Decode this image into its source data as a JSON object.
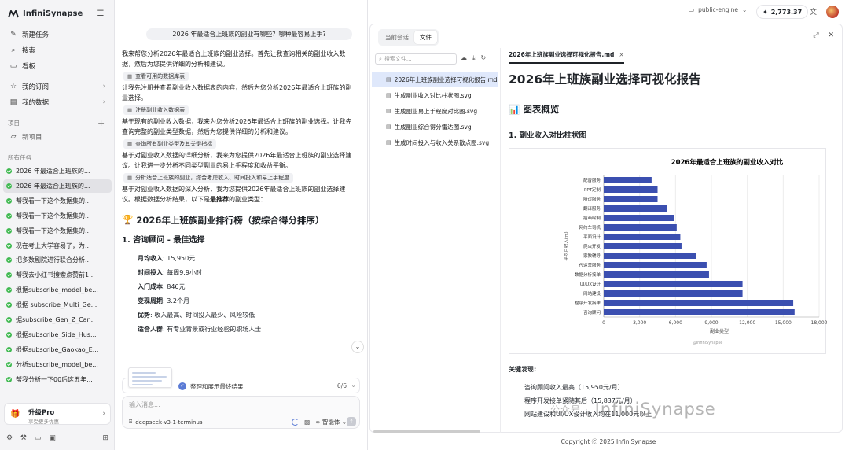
{
  "app": {
    "name": "InfiniSynapse"
  },
  "sidebar": {
    "nav": [
      {
        "label": "新建任务",
        "icon": "edit-icon"
      },
      {
        "label": "搜索",
        "icon": "search-icon"
      },
      {
        "label": "看板",
        "icon": "board-icon"
      },
      {
        "label": "我的订阅",
        "icon": "star-icon"
      },
      {
        "label": "我的数据",
        "icon": "data-icon"
      }
    ],
    "projects_label": "项目",
    "new_project": "新项目",
    "tasks_label": "所有任务",
    "tasks": [
      "2026 年最适合上班族的...",
      "2026 年最适合上班族的...",
      "帮我看一下这个数据集的...",
      "帮我看一下这个数据集的...",
      "帮我看一下这个数据集的...",
      "现在考上大学容易了，为...",
      "把多数剧院进行联合分析...",
      "帮我去小红书搜索点赞前1...",
      "根据subscribe_model_be...",
      "根据 subscribe_Multi_Ge...",
      "据subscribe_Gen_Z_Car...",
      "根据subscribe_Side_Hus...",
      "根据subscribe_Gaokao_E...",
      "分析subscribe_model_be...",
      "帮我分析一下00后这五年..."
    ],
    "active_task": 1,
    "upgrade": {
      "title": "升级Pro",
      "subtitle": "享受更多优惠"
    }
  },
  "chat": {
    "question": "2026 年最适合上班族的副业有哪些？哪种最容易上手?",
    "p1": "我来帮您分析2026年最适合上班族的副业选择。首先让我查询相关的副业收入数据，然后为您提供详细的分析和建议。",
    "tool1": "查看可用的数据库表",
    "p2": "让我先注册并查看副业收入数据表的内容，然后为您分析2026年最适合上班族的副业选择。",
    "tool2": "注册副业收入数据表",
    "p3": "基于现有的副业收入数据，我来为您分析2026年最适合上班族的副业选择。让我先查询完整的副业类型数据，然后为您提供详细的分析和建议。",
    "tool3": "查询所有副业类型及其关键指标",
    "p4": "基于对副业收入数据的详细分析，我来为您提供2026年最适合上班族的副业选择建议。让我进一步分析不同类型副业的易上手程度和收益平衡。",
    "tool4": "分析适合上班族的副业，综合考虑收入、时间投入和易上手程度",
    "p5a": "基于对副业收入数据的深入分析，我为您提供2026年最适合上班族的副业选择建议。根据数据分析结果，以下是",
    "p5b": "最推荐",
    "p5c": "的副业类型：",
    "rank_icon": "🏆",
    "rank_title": "2026年上班族副业排行榜（按综合得分排序）",
    "item_title": "1. 咨询顾问 - 最佳选择",
    "details": [
      {
        "k": "月均收入",
        "v": ": 15,950元"
      },
      {
        "k": "时间投入",
        "v": ": 每周9.9小时"
      },
      {
        "k": "入门成本",
        "v": ": 846元"
      },
      {
        "k": "变现周期",
        "v": ": 3.2个月"
      },
      {
        "k": "优势",
        "v": ": 收入最高、时间投入最少、风险较低"
      },
      {
        "k": "适合人群",
        "v": ": 有专业背景或行业经验的职场人士"
      }
    ],
    "progress": {
      "label": "整理和展示最终结果",
      "count": "6/6"
    },
    "input_placeholder": "输入消息...",
    "model": "deepseek-v3-1-terminus",
    "agent_label": "智能体"
  },
  "topbar": {
    "engine": "public-engine",
    "credits": "2,773.37"
  },
  "panel": {
    "tabs": [
      "当前会话",
      "文件"
    ],
    "active_tab": 1,
    "search_placeholder": "搜索文件...",
    "files": [
      "2026年上班族副业选择可视化报告.md",
      "生成副业收入对比柱状图.svg",
      "生成副业易上手程度对比图.svg",
      "生成副业综合得分雷达图.svg",
      "生成时间投入与收入关系散点图.svg"
    ],
    "selected_file": 0,
    "doc_tab": "2026年上班族副业选择可视化报告.md",
    "doc": {
      "title": "2026年上班族副业选择可视化报告",
      "overview_icon": "📊",
      "overview": "图表概览",
      "chart_heading": "1. 副业收入对比柱状图",
      "findings_label": "关键发现:",
      "findings": [
        "咨询顾问收入最高（15,950元/月）",
        "程序开发接单紧随其后（15,837元/月）",
        "网站建设和UI/UX设计收入均在11,000元以上"
      ]
    }
  },
  "chart_data": {
    "type": "bar",
    "orientation": "horizontal",
    "title": "2026年最适合上班族的副业收入对比",
    "xlabel": "副业类型",
    "ylabel": "平均月收入(元)",
    "categories": [
      "配音服务",
      "PPT定制",
      "陪诊服务",
      "翻译服务",
      "插画绘制",
      "网约车司机",
      "平面设计",
      "爬虫开发",
      "家教辅导",
      "代运营服务",
      "数据分析接单",
      "UI/UX设计",
      "网站建设",
      "程序开发接单",
      "咨询顾问"
    ],
    "values": [
      4000,
      4500,
      4500,
      5300,
      5900,
      6100,
      6400,
      6500,
      7700,
      8600,
      8800,
      11600,
      11600,
      15837,
      15950
    ],
    "xlim": [
      0,
      18000
    ],
    "ticks": [
      "0",
      "3,000",
      "6,000",
      "9,000",
      "12,000",
      "15,000",
      "18,000"
    ],
    "tick_values": [
      0,
      3000,
      6000,
      9000,
      12000,
      15000,
      18000
    ],
    "bar_color": "#3b4fb0",
    "grid": true,
    "credit": "@InfiniSynapse"
  },
  "footer": "Copyright Ⓒ 2025 InfiniSynapse",
  "watermark": {
    "prefix": "公众号 · ",
    "name": "InfiniSynapse"
  }
}
